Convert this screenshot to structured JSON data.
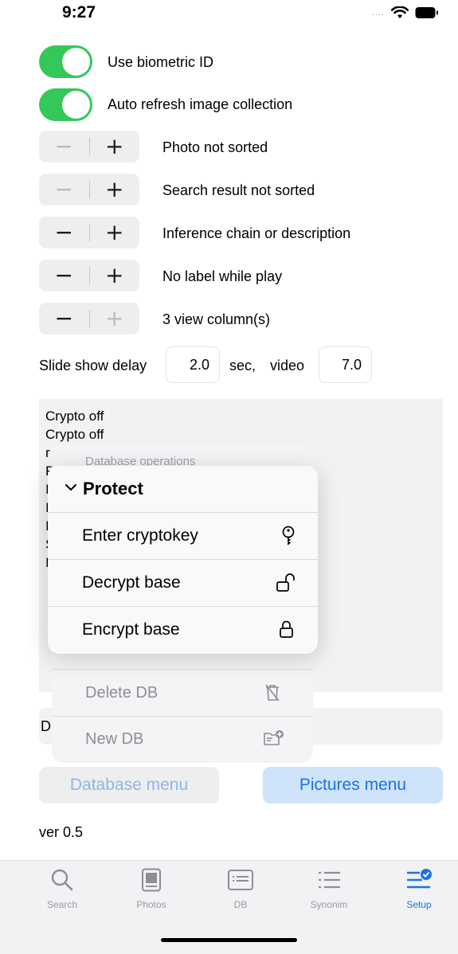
{
  "status": {
    "time": "9:27",
    "dots": "....",
    "wifi_icon": "wifi-icon",
    "battery_icon": "battery-icon"
  },
  "toggles": [
    {
      "label": "Use biometric ID",
      "on": true
    },
    {
      "label": "Auto refresh image collection",
      "on": true
    }
  ],
  "steppers": [
    {
      "label": "Photo not sorted",
      "minus": "−",
      "plus": "+"
    },
    {
      "label": "Search result not sorted",
      "minus": "−",
      "plus": "+"
    },
    {
      "label": "Inference chain or description",
      "minus": "−",
      "plus": "+"
    },
    {
      "label": "No label while play",
      "minus": "−",
      "plus": "+"
    },
    {
      "label": "3 view column(s)",
      "minus": "−",
      "plus": "+"
    }
  ],
  "slideshow": {
    "label": "Slide show delay",
    "delay": "2.0",
    "sec_label": "sec,",
    "video_label": "video",
    "video_delay": "7.0"
  },
  "log": {
    "lines": [
      "Crypto off",
      "Crypto off",
      "r",
      "F",
      "I",
      "I",
      "I",
      "S",
      "I"
    ]
  },
  "db_menu": {
    "header": "Database operations",
    "delete_label": "Delete DB",
    "new_label": "New DB",
    "delete_icon": "trash-icon",
    "new_icon": "folder-plus-icon",
    "partial_row_label": "D"
  },
  "protect_menu": {
    "title": "Protect",
    "items": [
      {
        "label": "Enter cryptokey",
        "icon": "key-icon"
      },
      {
        "label": "Decrypt base",
        "icon": "unlock-icon"
      },
      {
        "label": "Encrypt base",
        "icon": "lock-icon"
      }
    ]
  },
  "buttons": {
    "database_menu": "Database menu",
    "pictures_menu": "Pictures menu"
  },
  "version": "ver 0.5",
  "tabbar": {
    "tabs": [
      {
        "label": "Search",
        "icon": "search-icon"
      },
      {
        "label": "Photos",
        "icon": "photos-icon"
      },
      {
        "label": "DB",
        "icon": "db-icon"
      },
      {
        "label": "Synonim",
        "icon": "list-icon"
      },
      {
        "label": "Setup",
        "icon": "setup-icon",
        "active": true
      }
    ]
  },
  "colors": {
    "accent": "#1a73e8",
    "toggle_on": "#34c759"
  }
}
